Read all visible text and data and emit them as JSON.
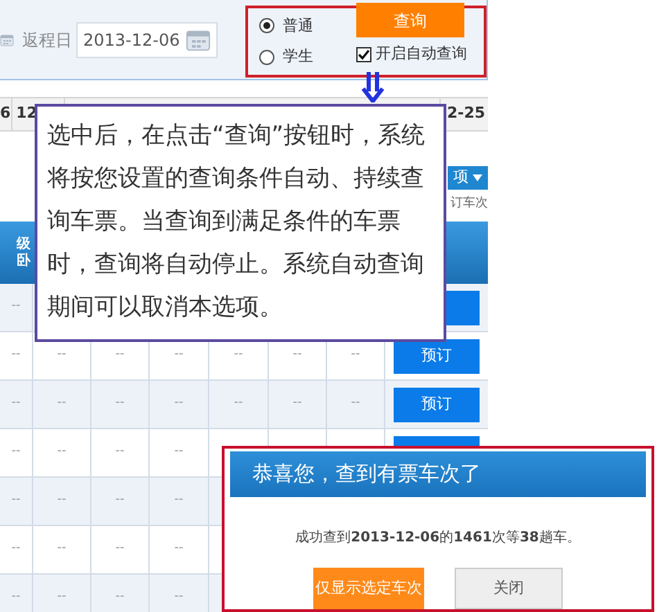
{
  "search_panel": {
    "return_date_label": "返程日",
    "return_date": "2013-12-06",
    "passenger_types": [
      {
        "label": "普通",
        "selected": true
      },
      {
        "label": "学生",
        "selected": false
      }
    ],
    "query_button": "查询",
    "auto_query": {
      "label": "开启自动查询",
      "checked": true
    }
  },
  "date_tabs": [
    {
      "label": "6"
    },
    {
      "label": "12"
    },
    {
      "label": "2-25"
    }
  ],
  "options_button": "项",
  "filter_text": "订车次",
  "table": {
    "header": [
      "级",
      "卧"
    ],
    "rows": [
      {
        "cells": [
          "--"
        ],
        "button": null
      },
      {
        "cells": [
          "--",
          "--",
          "--",
          "--",
          "--",
          "--",
          "--"
        ],
        "button": "预订"
      },
      {
        "cells": [
          "--",
          "--",
          "--",
          "--",
          "--",
          "--",
          "--"
        ],
        "button": "预订"
      },
      {
        "cells": [
          "--",
          "--",
          "--",
          "--"
        ],
        "button": null
      },
      {
        "cells": [
          "--",
          "--",
          "--",
          "--"
        ]
      },
      {
        "cells": [
          "--",
          "--",
          "--",
          "--"
        ]
      },
      {
        "cells": [
          "--",
          "--",
          "--",
          "--"
        ]
      }
    ]
  },
  "callout": {
    "text": "选中后，在点击“查询”按钮时，系统将按您设置的查询条件自动、持续查询车票。当查询到满足条件的车票时，查询将自动停止。系统自动查询期间可以取消本选项。"
  },
  "dialog": {
    "title": "恭喜您，查到有票车次了",
    "message": "成功查到**2013-12-06**的**1461**次等**38**趟车。",
    "buttons": [
      {
        "label": "仅显示选定车次",
        "kind": "primary"
      },
      {
        "label": "关闭",
        "kind": "secondary"
      }
    ]
  }
}
